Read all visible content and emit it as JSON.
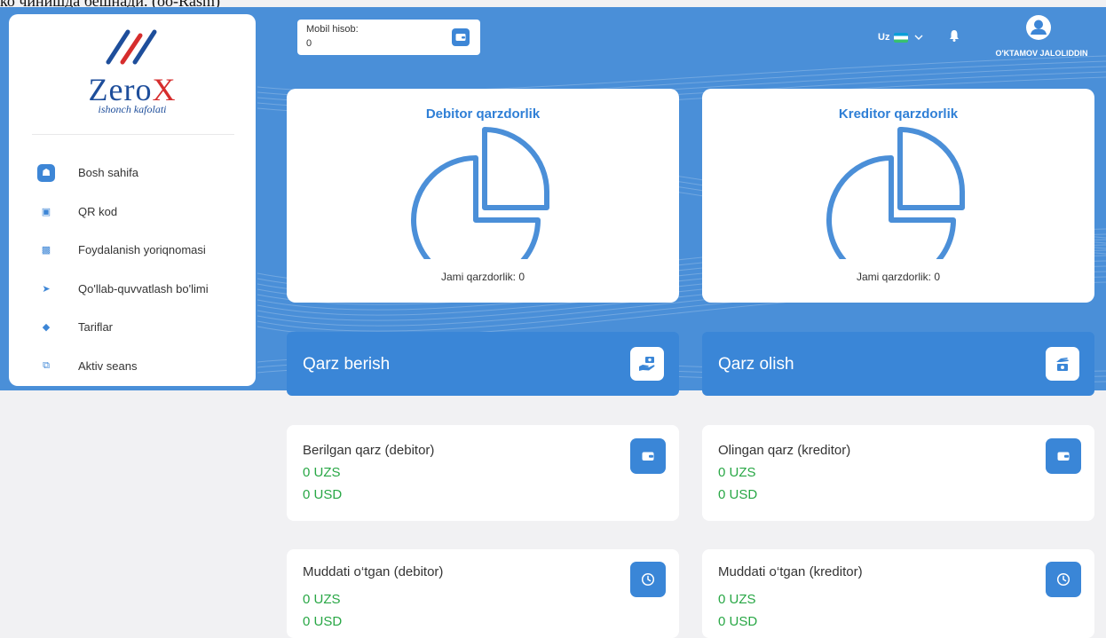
{
  "caption": "ко чинишда бешнади. (оо-Rasm)",
  "brand": {
    "name_main": "Zero",
    "name_x": "X",
    "tagline": "ishonch kafolati"
  },
  "sidebar": {
    "items": [
      {
        "label": "Bosh sahifa",
        "icon": "home-icon",
        "active": true
      },
      {
        "label": "QR kod",
        "icon": "qr-code-icon",
        "active": false
      },
      {
        "label": "Foydalanish yoriqnomasi",
        "icon": "book-icon",
        "active": false
      },
      {
        "label": "Qo'llab-quvvatlash bo'limi",
        "icon": "send-icon",
        "active": false
      },
      {
        "label": "Tariflar",
        "icon": "tag-icon",
        "active": false
      },
      {
        "label": "Aktiv seans",
        "icon": "devices-icon",
        "active": false
      }
    ]
  },
  "header": {
    "mobil_label": "Mobil hisob:",
    "mobil_value": "0",
    "language": "Uz",
    "user_name": "O'KTAMOV JALOLIDDIN"
  },
  "debitor_chart": {
    "title": "Debitor qarzdorlik",
    "total": "Jami qarzdorlik: 0"
  },
  "kreditor_chart": {
    "title": "Kreditor qarzdorlik",
    "total": "Jami qarzdorlik: 0"
  },
  "actions": {
    "give": "Qarz berish",
    "take": "Qarz olish"
  },
  "stats": {
    "given": {
      "label": "Berilgan qarz (debitor)",
      "uzs": "0 UZS",
      "usd": "0 USD"
    },
    "received": {
      "label": "Olingan qarz (kreditor)",
      "uzs": "0 UZS",
      "usd": "0 USD"
    },
    "overdue_debitor": {
      "label": "Muddati o‘tgan (debitor)",
      "uzs": "0 UZS",
      "usd": "0 USD"
    },
    "overdue_kreditor": {
      "label": "Muddati o‘tgan (kreditor)",
      "uzs": "0 UZS",
      "usd": "0 USD"
    }
  },
  "colors": {
    "primary": "#3a86d7",
    "brand_blue": "#1e4e9b",
    "brand_red": "#d62d2d",
    "amount_green": "#28a745"
  }
}
